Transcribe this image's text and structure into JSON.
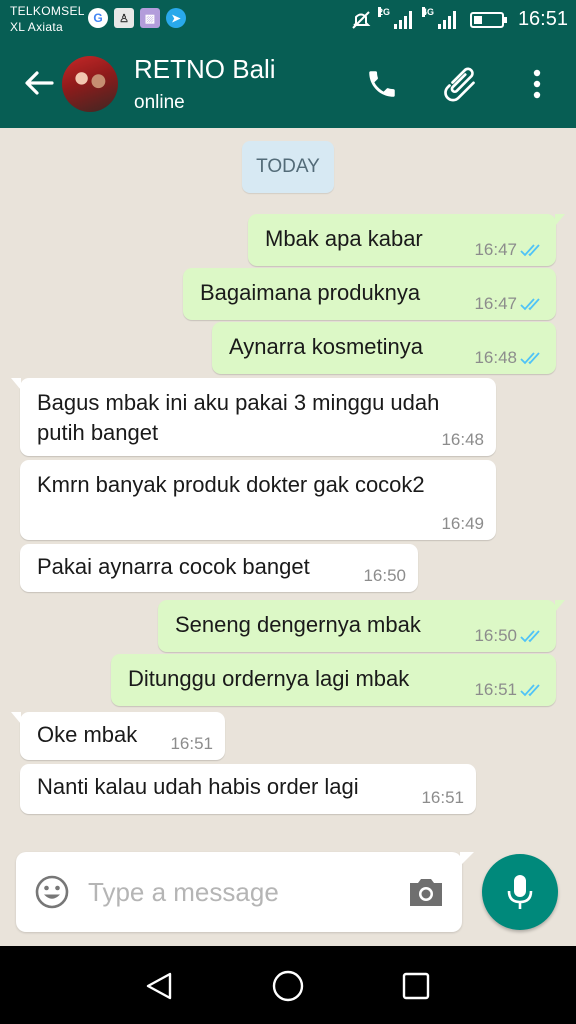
{
  "status_bar": {
    "carrier_1": "TELKOMSEL",
    "carrier_2": "XL Axiata",
    "network_1": "2G",
    "network_2": "4G",
    "time": "16:51",
    "battery_level": 0.3,
    "icons": [
      "google-icon",
      "notification-icon",
      "gallery-icon",
      "telegram-icon",
      "mute-icon",
      "signal-icon",
      "battery-icon"
    ]
  },
  "header": {
    "contact_name": "RETNO Bali",
    "status": "online",
    "color": "#075e54"
  },
  "chat": {
    "day_label": "TODAY",
    "colors": {
      "outgoing": "#dcf8c6",
      "incoming": "#ffffff",
      "read_ticks": "#4fc3f7"
    },
    "messages": [
      {
        "direction": "out",
        "text": "Mbak apa kabar",
        "time": "16:47",
        "status": "read"
      },
      {
        "direction": "out",
        "text": "Bagaimana produknya",
        "time": "16:47",
        "status": "read"
      },
      {
        "direction": "out",
        "text": "Aynarra kosmetinya",
        "time": "16:48",
        "status": "read"
      },
      {
        "direction": "in",
        "text": "Bagus mbak ini aku pakai 3 minggu udah putih banget",
        "time": "16:48"
      },
      {
        "direction": "in",
        "text": "Kmrn banyak produk dokter gak cocok2",
        "time": "16:49"
      },
      {
        "direction": "in",
        "text": "Pakai aynarra cocok banget",
        "time": "16:50"
      },
      {
        "direction": "out",
        "text": "Seneng dengernya mbak",
        "time": "16:50",
        "status": "read"
      },
      {
        "direction": "out",
        "text": "Ditunggu ordernya lagi mbak",
        "time": "16:51",
        "status": "read"
      },
      {
        "direction": "in",
        "text": "Oke mbak",
        "time": "16:51"
      },
      {
        "direction": "in",
        "text": "Nanti kalau udah habis order lagi",
        "time": "16:51"
      }
    ]
  },
  "composer": {
    "placeholder": "Type a message",
    "value": "",
    "mic_color": "#00897b"
  }
}
